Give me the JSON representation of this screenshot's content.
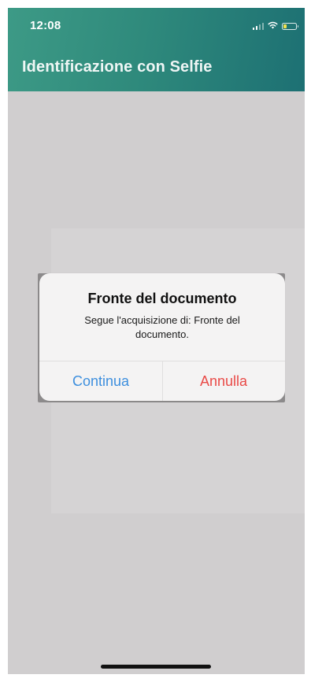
{
  "status_bar": {
    "time": "12:08",
    "signal_bars_active": 2,
    "battery_level": 0.25,
    "battery_color": "#f4e04d"
  },
  "nav": {
    "title": "Identificazione con Selfie"
  },
  "alert": {
    "title": "Fronte del documento",
    "message": "Segue l'acquisizione di: Fronte del documento.",
    "continue_label": "Continua",
    "cancel_label": "Annulla"
  },
  "colors": {
    "header_start": "#3d9a86",
    "header_end": "#1d7073",
    "continue": "#3d8fde",
    "cancel": "#e94a47",
    "background": "#d0cecf"
  },
  "icons": {
    "signal": "signal-icon",
    "wifi": "wifi-icon",
    "battery": "battery-icon"
  }
}
